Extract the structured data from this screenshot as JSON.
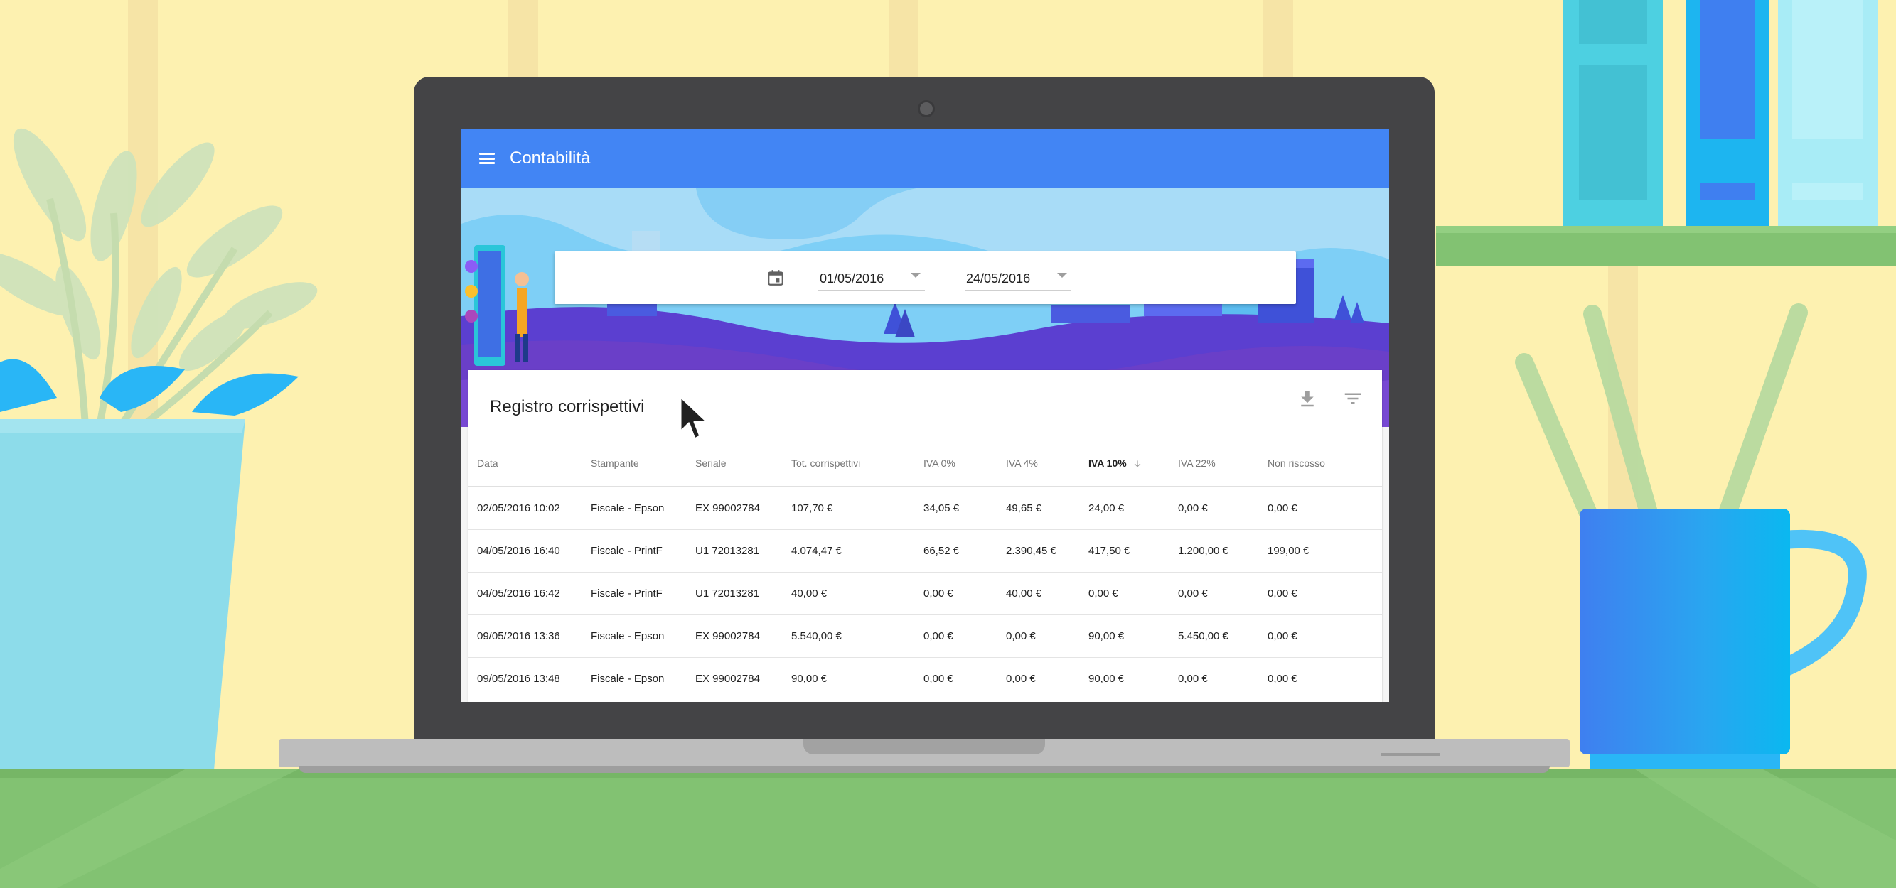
{
  "app": {
    "title": "Contabilità"
  },
  "date_filter": {
    "from": "01/05/2016",
    "to": "24/05/2016"
  },
  "register": {
    "title": "Registro corrispettivi",
    "columns": [
      "Data",
      "Stampante",
      "Seriale",
      "Tot. corrispettivi",
      "IVA 0%",
      "IVA 4%",
      "IVA 10%",
      "IVA 22%",
      "Non riscosso"
    ],
    "sorted_column": "IVA 10%",
    "rows": [
      [
        "02/05/2016 10:02",
        "Fiscale - Epson",
        "EX 99002784",
        "107,70 €",
        "34,05 €",
        "49,65 €",
        "24,00 €",
        "0,00 €",
        "0,00 €"
      ],
      [
        "04/05/2016 16:40",
        "Fiscale - PrintF",
        "U1 72013281",
        "4.074,47 €",
        "66,52 €",
        "2.390,45 €",
        "417,50 €",
        "1.200,00 €",
        "199,00 €"
      ],
      [
        "04/05/2016 16:42",
        "Fiscale - PrintF",
        "U1 72013281",
        "40,00 €",
        "0,00 €",
        "40,00 €",
        "0,00 €",
        "0,00 €",
        "0,00 €"
      ],
      [
        "09/05/2016 13:36",
        "Fiscale - Epson",
        "EX 99002784",
        "5.540,00 €",
        "0,00 €",
        "0,00 €",
        "90,00 €",
        "5.450,00 €",
        "0,00 €"
      ],
      [
        "09/05/2016 13:48",
        "Fiscale - Epson",
        "EX 99002784",
        "90,00 €",
        "0,00 €",
        "0,00 €",
        "90,00 €",
        "0,00 €",
        "0,00 €"
      ]
    ]
  },
  "icons": {
    "menu": "menu-icon",
    "calendar": "calendar-icon",
    "download": "download-icon",
    "filter": "filter-icon",
    "sort": "arrow-down-icon",
    "cursor": "mouse-pointer-icon"
  },
  "colors": {
    "app_bar": "#4285f4",
    "hero_purple": "#6a3fc8",
    "hero_sky": "#7ecff6",
    "wall": "#fdf1b0",
    "floor": "#82c272"
  }
}
